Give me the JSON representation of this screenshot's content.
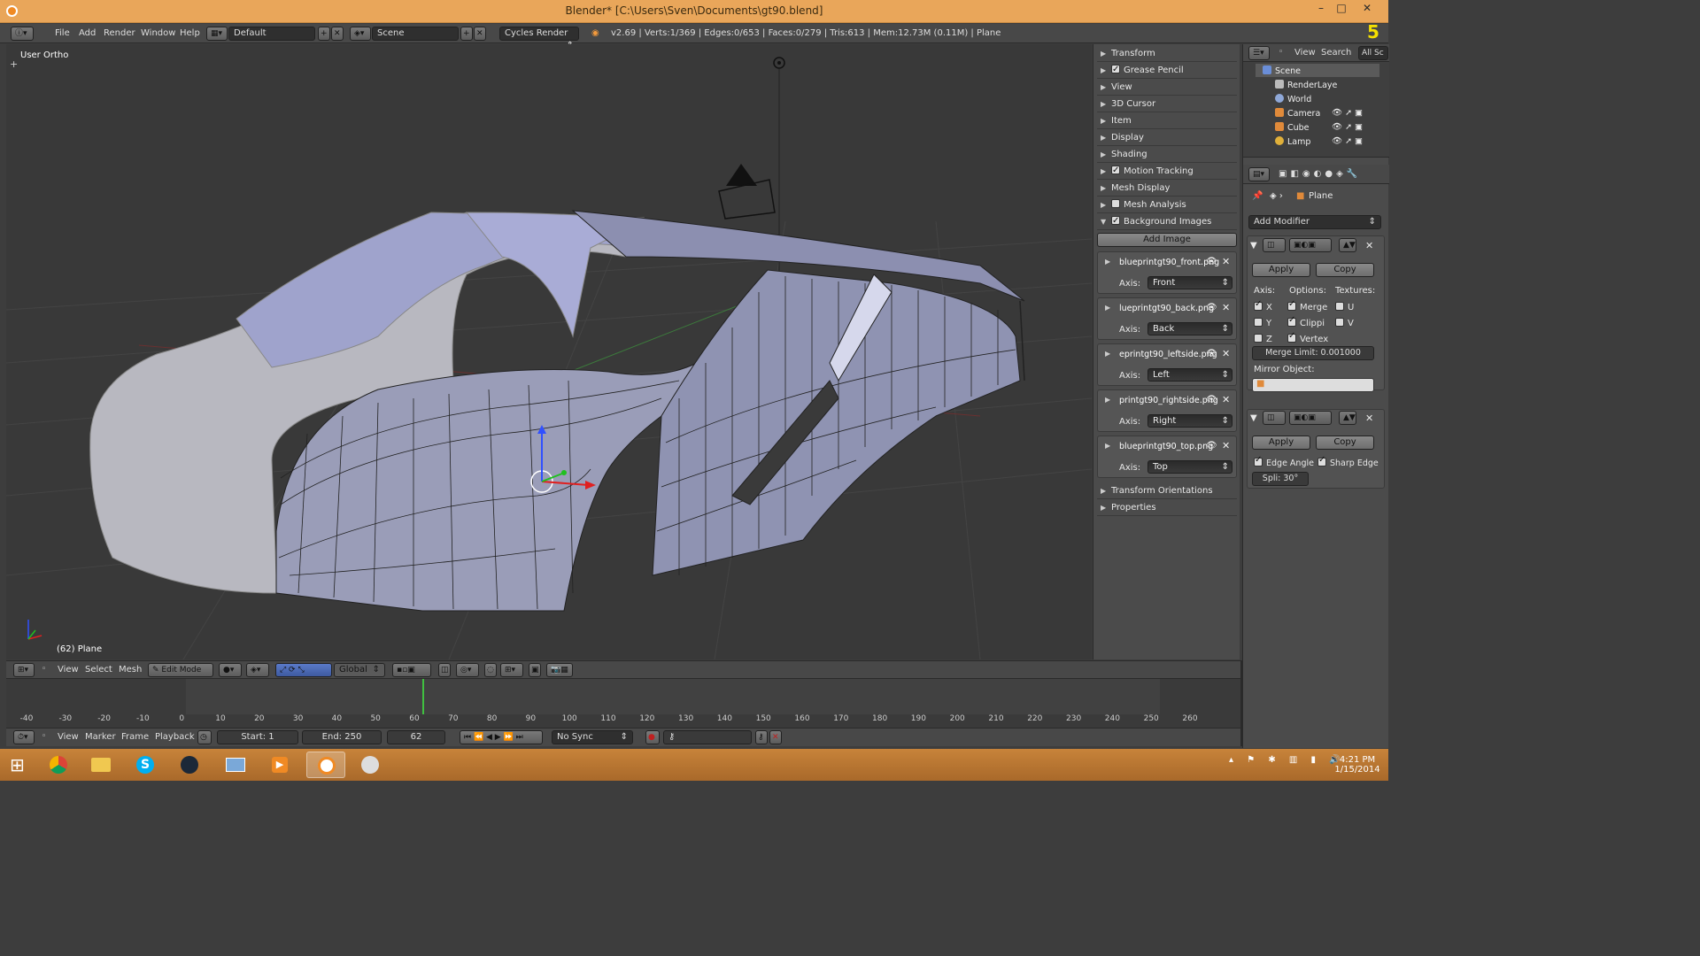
{
  "window": {
    "title": "Blender* [C:\\Users\\Sven\\Documents\\gt90.blend]",
    "minimize": "–",
    "maximize": "□",
    "close": "✕"
  },
  "info_header": {
    "menus": [
      "File",
      "Add",
      "Render",
      "Window",
      "Help"
    ],
    "layout": "Default",
    "scene": "Scene",
    "engine": "Cycles Render",
    "stats": "v2.69 | Verts:1/369 | Edges:0/653 | Faces:0/279 | Tris:613 | Mem:12.73M (0.11M) | Plane"
  },
  "viewport": {
    "view_label": "User Ortho",
    "object_label": "(62) Plane"
  },
  "n_panel": {
    "sections": [
      {
        "label": "Transform",
        "check": false,
        "expanded": false
      },
      {
        "label": "Grease Pencil",
        "check": true,
        "expanded": false
      },
      {
        "label": "View",
        "check": false,
        "expanded": false
      },
      {
        "label": "3D Cursor",
        "check": false,
        "expanded": false
      },
      {
        "label": "Item",
        "check": false,
        "expanded": false
      },
      {
        "label": "Display",
        "check": false,
        "expanded": false
      },
      {
        "label": "Shading",
        "check": false,
        "expanded": false
      },
      {
        "label": "Motion Tracking",
        "check": true,
        "expanded": false
      },
      {
        "label": "Mesh Display",
        "check": false,
        "expanded": false
      },
      {
        "label": "Mesh Analysis",
        "check": true,
        "expanded": false
      },
      {
        "label": "Background Images",
        "check": true,
        "expanded": true
      }
    ],
    "add_image": "Add Image",
    "axis_label": "Axis:",
    "bg_images": [
      {
        "name": "blueprintgt90_front.png",
        "axis": "Front"
      },
      {
        "name": "lueprintgt90_back.png",
        "axis": "Back"
      },
      {
        "name": "eprintgt90_leftside.png",
        "axis": "Left"
      },
      {
        "name": "printgt90_rightside.png",
        "axis": "Right"
      },
      {
        "name": "blueprintgt90_top.png",
        "axis": "Top"
      }
    ],
    "after_sections": [
      "Transform Orientations",
      "Properties"
    ]
  },
  "outliner": {
    "menus": [
      "View",
      "Search",
      "All Sc"
    ],
    "items": [
      {
        "label": "Scene",
        "color": "#6a8ed8"
      },
      {
        "label": "RenderLaye",
        "color": "#bbbbbb"
      },
      {
        "label": "World",
        "color": "#8fa8d8"
      },
      {
        "label": "Camera",
        "color": "#e08a3a"
      },
      {
        "label": "Cube",
        "color": "#e08a3a"
      },
      {
        "label": "Lamp",
        "color": "#e0b03a"
      }
    ]
  },
  "properties": {
    "object": "Plane",
    "add_modifier": "Add Modifier",
    "mirror": {
      "apply": "Apply",
      "copy": "Copy",
      "axis_label": "Axis:",
      "options_label": "Options:",
      "textures_label": "Textures:",
      "x": "X",
      "y": "Y",
      "z": "Z",
      "merge": "Merge",
      "clip": "Clippi",
      "vertex": "Vertex",
      "u": "U",
      "v": "V",
      "merge_limit": "Merge Limit: 0.001000",
      "mirror_object": "Mirror Object:"
    },
    "edge_split": {
      "apply": "Apply",
      "copy": "Copy",
      "edge_angle": "Edge Angle",
      "sharp_edge": "Sharp Edge",
      "split": "Spli: 30°"
    }
  },
  "view3d_header": {
    "menus": [
      "View",
      "Select",
      "Mesh"
    ],
    "mode": "Edit Mode",
    "orientation": "Global"
  },
  "timeline": {
    "ticks": [
      "-40",
      "-30",
      "-20",
      "-10",
      "0",
      "10",
      "20",
      "30",
      "40",
      "50",
      "60",
      "70",
      "80",
      "90",
      "100",
      "110",
      "120",
      "130",
      "140",
      "150",
      "160",
      "170",
      "180",
      "190",
      "200",
      "210",
      "220",
      "230",
      "240",
      "250",
      "260"
    ],
    "current_frame": 62
  },
  "timeline_header": {
    "menus": [
      "View",
      "Marker",
      "Frame",
      "Playback"
    ],
    "start": "Start: 1",
    "end": "End: 250",
    "frame": "62",
    "sync": "No Sync"
  },
  "taskbar": {
    "time": "4:21 PM",
    "date": "1/15/2014"
  },
  "corner_badge": "5"
}
